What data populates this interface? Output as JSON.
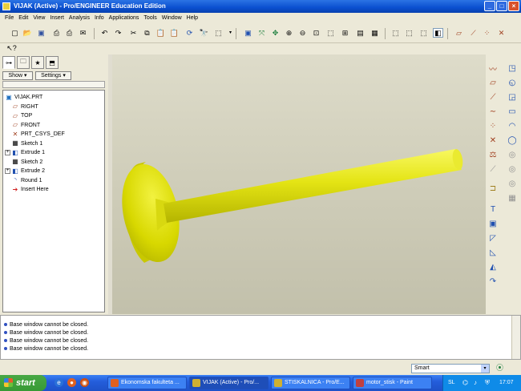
{
  "window": {
    "title": "VIJAK (Active) - Pro/ENGINEER Education Edition",
    "btn_min": "_",
    "btn_max": "□",
    "btn_close": "×"
  },
  "menu": [
    "File",
    "Edit",
    "View",
    "Insert",
    "Analysis",
    "Info",
    "Applications",
    "Tools",
    "Window",
    "Help"
  ],
  "navigator": {
    "show_label": "Show ▾",
    "settings_label": "Settings ▾"
  },
  "tree": [
    {
      "label": "VIJAK.PRT",
      "icon": "part-icon",
      "glyph": "▣",
      "indent": 0,
      "expand": ""
    },
    {
      "label": "RIGHT",
      "icon": "datum-plane-icon",
      "glyph": "▱",
      "indent": 1,
      "expand": ""
    },
    {
      "label": "TOP",
      "icon": "datum-plane-icon",
      "glyph": "▱",
      "indent": 1,
      "expand": ""
    },
    {
      "label": "FRONT",
      "icon": "datum-plane-icon",
      "glyph": "▱",
      "indent": 1,
      "expand": ""
    },
    {
      "label": "PRT_CSYS_DEF",
      "icon": "csys-icon",
      "glyph": "✕",
      "indent": 1,
      "expand": ""
    },
    {
      "label": "Sketch 1",
      "icon": "sketch-icon",
      "glyph": "▦",
      "indent": 1,
      "expand": ""
    },
    {
      "label": "Extrude 1",
      "icon": "extrude-icon",
      "glyph": "◧",
      "indent": 1,
      "expand": "+"
    },
    {
      "label": "Sketch 2",
      "icon": "sketch-icon",
      "glyph": "▦",
      "indent": 1,
      "expand": ""
    },
    {
      "label": "Extrude 2",
      "icon": "extrude-icon",
      "glyph": "◧",
      "indent": 1,
      "expand": "+"
    },
    {
      "label": "Round 1",
      "icon": "round-icon",
      "glyph": "◝",
      "indent": 1,
      "expand": ""
    },
    {
      "label": "Insert Here",
      "icon": "insert-here-arrow-icon",
      "glyph": "➔",
      "indent": 1,
      "expand": ""
    }
  ],
  "messages": [
    "Base window cannot be closed.",
    "Base window cannot be closed.",
    "Base window cannot be closed.",
    "Base window cannot be closed."
  ],
  "status": {
    "filter_value": "Smart",
    "filter_arrow": "▾"
  },
  "taskbar": {
    "start_label": "start",
    "tasks": [
      {
        "label": "Ekonomska fakulteta ...",
        "color": "#e06020",
        "active": false
      },
      {
        "label": "VIJAK (Active) - Pro/...",
        "color": "#d0b030",
        "active": true
      },
      {
        "label": "STISKALNICA - Pro/E...",
        "color": "#d0b030",
        "active": false
      },
      {
        "label": "motor_stisk - Paint",
        "color": "#c04040",
        "active": false
      }
    ],
    "tray_lang": "SL",
    "clock": "17:07"
  },
  "colors": {
    "part_yellow": "#e8e820",
    "part_shade": "#a8a800",
    "accent_blue": "#0a4fd0"
  }
}
